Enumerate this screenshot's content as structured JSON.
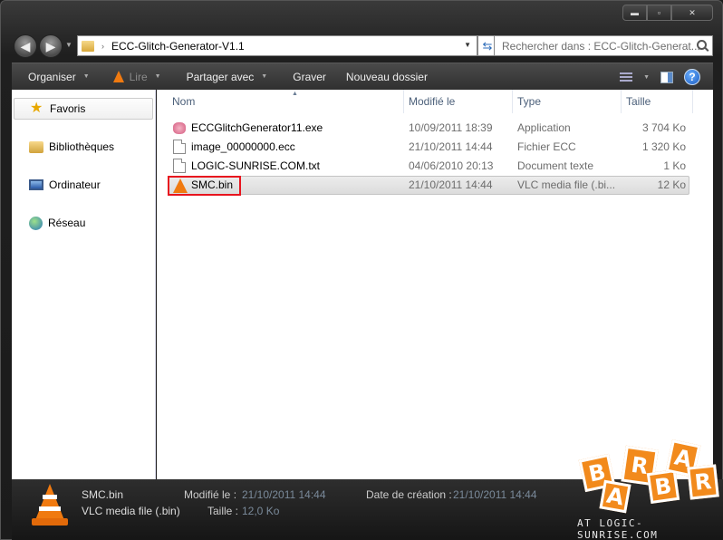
{
  "window": {
    "caption_buttons": {
      "minimize": "▬",
      "maximize": "▫",
      "close": "✕"
    }
  },
  "navigation": {
    "address_path": "ECC-Glitch-Generator-V1.1",
    "search_placeholder": "Rechercher dans : ECC-Glitch-Generat..."
  },
  "toolbar": {
    "organiser": "Organiser",
    "lire": "Lire",
    "partager": "Partager avec",
    "graver": "Graver",
    "nouveau_dossier": "Nouveau dossier",
    "help": "?"
  },
  "sidebar": {
    "items": [
      {
        "label": "Favoris",
        "icon": "star-icon"
      },
      {
        "label": "Bibliothèques",
        "icon": "libraries-icon"
      },
      {
        "label": "Ordinateur",
        "icon": "computer-icon"
      },
      {
        "label": "Réseau",
        "icon": "network-icon"
      }
    ]
  },
  "file_list": {
    "columns": {
      "name": "Nom",
      "modified": "Modifié le",
      "type": "Type",
      "size": "Taille"
    },
    "rows": [
      {
        "name": "ECCGlitchGenerator11.exe",
        "modified": "10/09/2011 18:39",
        "type": "Application",
        "size": "3 704 Ko",
        "icon": "exe-icon"
      },
      {
        "name": "image_00000000.ecc",
        "modified": "21/10/2011 14:44",
        "type": "Fichier ECC",
        "size": "1 320 Ko",
        "icon": "file-icon"
      },
      {
        "name": "LOGIC-SUNRISE.COM.txt",
        "modified": "04/06/2010 20:13",
        "type": "Document texte",
        "size": "1 Ko",
        "icon": "text-file-icon"
      },
      {
        "name": "SMC.bin",
        "modified": "21/10/2011 14:44",
        "type": "VLC media file (.bi...",
        "size": "12 Ko",
        "icon": "vlc-icon",
        "selected": true
      }
    ]
  },
  "details": {
    "name": "SMC.bin",
    "type": "VLC media file (.bin)",
    "modified_label": "Modifié le :",
    "modified_value": "21/10/2011 14:44",
    "created_label": "Date de création :",
    "created_value": "21/10/2011 14:44",
    "size_label": "Taille :",
    "size_value": "12,0 Ko"
  },
  "watermark": {
    "letters": [
      "B",
      "A",
      "R",
      "B",
      "A",
      "R"
    ],
    "caption": "AT LOGIC-SUNRISE.COM"
  }
}
